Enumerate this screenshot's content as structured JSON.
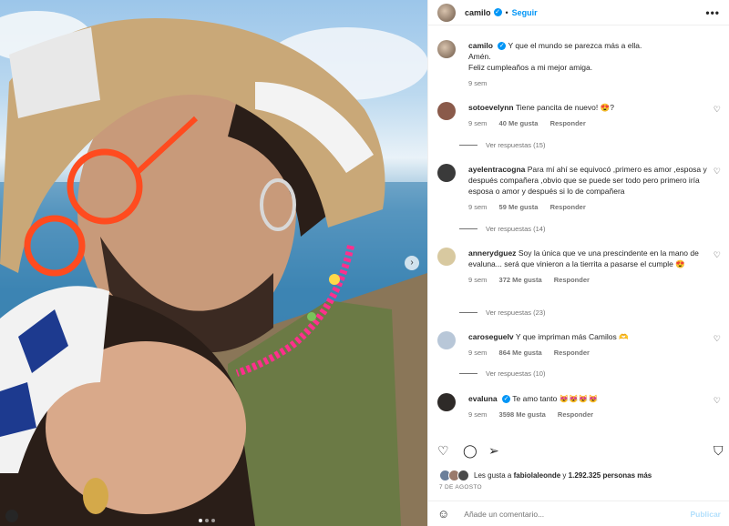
{
  "post": {
    "author": "camilo",
    "follow_label": "Seguir",
    "separator": "•",
    "more_icon": "•••",
    "caption_lines": [
      "Y que el mundo se parezca más a ella.",
      "Amén.",
      "Feliz cumpleaños a mi mejor amiga."
    ],
    "caption_time": "9 sem",
    "date": "7 DE AGOSTO",
    "liked_by_prefix": "Les gusta a",
    "liked_by_user": "fabiolaleonde",
    "liked_by_join": "y",
    "liked_by_count": "1.292.325 personas más",
    "carousel_next": "›"
  },
  "comments": [
    {
      "user": "sotoevelynn",
      "text": "Tiene pancita de nuevo! 😍?",
      "time": "9 sem",
      "likes": "40 Me gusta",
      "reply": "Responder",
      "view_replies": "Ver respuestas (15)"
    },
    {
      "user": "ayelentracogna",
      "text": "Para mí ahí se equivocó ,primero es amor ,esposa y después compañera ,obvio que se puede ser todo pero primero iría esposa o amor y después si lo de compañera",
      "time": "9 sem",
      "likes": "59 Me gusta",
      "reply": "Responder",
      "view_replies": "Ver respuestas (14)"
    },
    {
      "user": "annerydguez",
      "text": "Soy la única que ve una prescindente en la mano de evaluna... será que vinieron a la tierrita a pasarse el cumple 😍",
      "time": "9 sem",
      "likes": "372 Me gusta",
      "reply": "Responder",
      "view_replies": "Ver respuestas (23)"
    },
    {
      "user": "caroseguelv",
      "text": "Y que impriman más Camilos 🫶",
      "time": "9 sem",
      "likes": "864 Me gusta",
      "reply": "Responder",
      "view_replies": "Ver respuestas (10)"
    },
    {
      "user": "evaluna",
      "text": "Te amo tanto 😻😻😻😻",
      "time": "9 sem",
      "likes": "3598 Me gusta",
      "reply": "Responder",
      "view_replies": ""
    }
  ],
  "icons": {
    "like": "♡",
    "comment": "◯",
    "share": "➢",
    "save": "⛉",
    "emoji": "☺",
    "verified": "✓",
    "comment_like": "♡"
  },
  "composer": {
    "placeholder": "Añade un comentario...",
    "publish_label": "Publicar"
  },
  "colors": {
    "accent": "#0095f6",
    "publish_disabled": "#b2dffc",
    "secondary_text": "#737373"
  }
}
